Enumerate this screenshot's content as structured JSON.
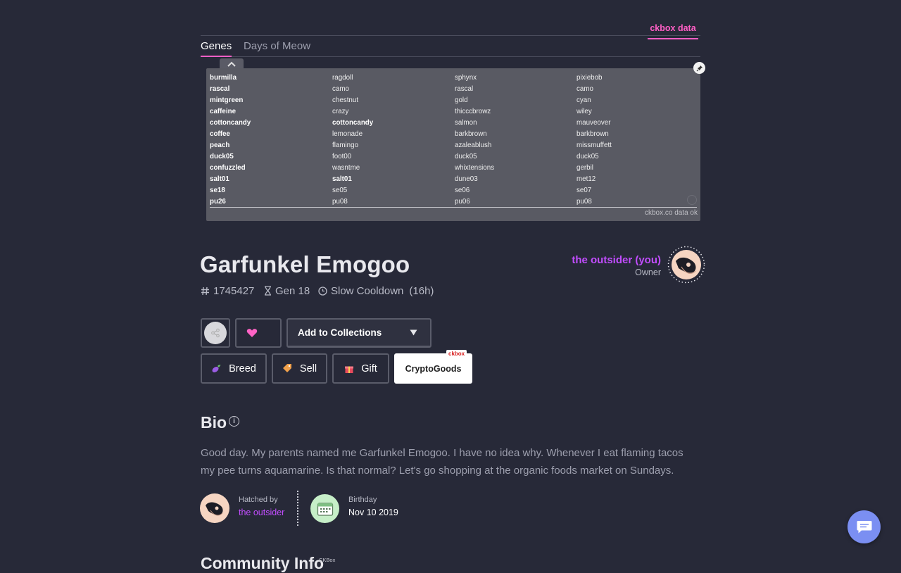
{
  "ckbox": {
    "tab_label": "ckbox data",
    "status": "ckbox.co data ok"
  },
  "tabs": [
    {
      "label": "Genes"
    },
    {
      "label": "Days of Meow"
    }
  ],
  "genes": {
    "rows": [
      [
        "burmilla",
        "ragdoll",
        "sphynx",
        "pixiebob"
      ],
      [
        "rascal",
        "camo",
        "rascal",
        "camo"
      ],
      [
        "mintgreen",
        "chestnut",
        "gold",
        "cyan"
      ],
      [
        "caffeine",
        "crazy",
        "thicccbrowz",
        "wiley"
      ],
      [
        "cottoncandy",
        "cottoncandy",
        "salmon",
        "mauveover"
      ],
      [
        "coffee",
        "lemonade",
        "barkbrown",
        "barkbrown"
      ],
      [
        "peach",
        "flamingo",
        "azaleablush",
        "missmuffett"
      ],
      [
        "duck05",
        "foot00",
        "duck05",
        "duck05"
      ],
      [
        "confuzzled",
        "wasntme",
        "whixtensions",
        "gerbil"
      ],
      [
        "salt01",
        "salt01",
        "dune03",
        "met12"
      ],
      [
        "se18",
        "se05",
        "se06",
        "se07"
      ],
      [
        "pu26",
        "pu08",
        "pu06",
        "pu08"
      ]
    ],
    "bold_cells": [
      [
        0,
        0
      ],
      [
        1,
        0
      ],
      [
        2,
        0
      ],
      [
        3,
        0
      ],
      [
        4,
        0
      ],
      [
        4,
        1
      ],
      [
        5,
        0
      ],
      [
        6,
        0
      ],
      [
        7,
        0
      ],
      [
        8,
        0
      ],
      [
        9,
        0
      ],
      [
        9,
        1
      ],
      [
        10,
        0
      ],
      [
        11,
        0
      ]
    ]
  },
  "kitty": {
    "name": "Garfunkel Emogoo",
    "id": "1745427",
    "generation": "Gen 18",
    "cooldown": "Slow Cooldown",
    "cooldown_time": "(16h)"
  },
  "owner": {
    "name": "the outsider (you)",
    "role": "Owner"
  },
  "actions": {
    "collections_label": "Add to Collections",
    "breed": "Breed",
    "sell": "Sell",
    "gift": "Gift",
    "cryptogoods": "CryptoGoods",
    "cryptogoods_tag": "ckbox"
  },
  "bio": {
    "title": "Bio",
    "text": "Good day. My parents named me Garfunkel Emogoo. I have no idea why. Whenever I eat flaming tacos my pee turns aquamarine. Is that normal? Let's go shopping at the organic foods market on Sundays."
  },
  "hatched": {
    "label": "Hatched by",
    "name": "the outsider"
  },
  "birthday": {
    "label": "Birthday",
    "value": "Nov 10 2019"
  },
  "next_section": {
    "title": "Community Info",
    "tag": "CKBox"
  },
  "colors": {
    "background": "#272938",
    "accent_pink": "#ff5fc6",
    "accent_purple": "#c24dff",
    "chat": "#7b8ff2"
  },
  "icons": [
    "collapse-chevron-icon",
    "pin-icon",
    "hash-icon",
    "hourglass-icon",
    "clock-icon",
    "share-icon",
    "heart-icon",
    "dropdown-arrow-icon",
    "eggplant-icon",
    "price-tag-icon",
    "gift-box-icon",
    "info-icon",
    "calendar-icon",
    "chat-icon"
  ]
}
